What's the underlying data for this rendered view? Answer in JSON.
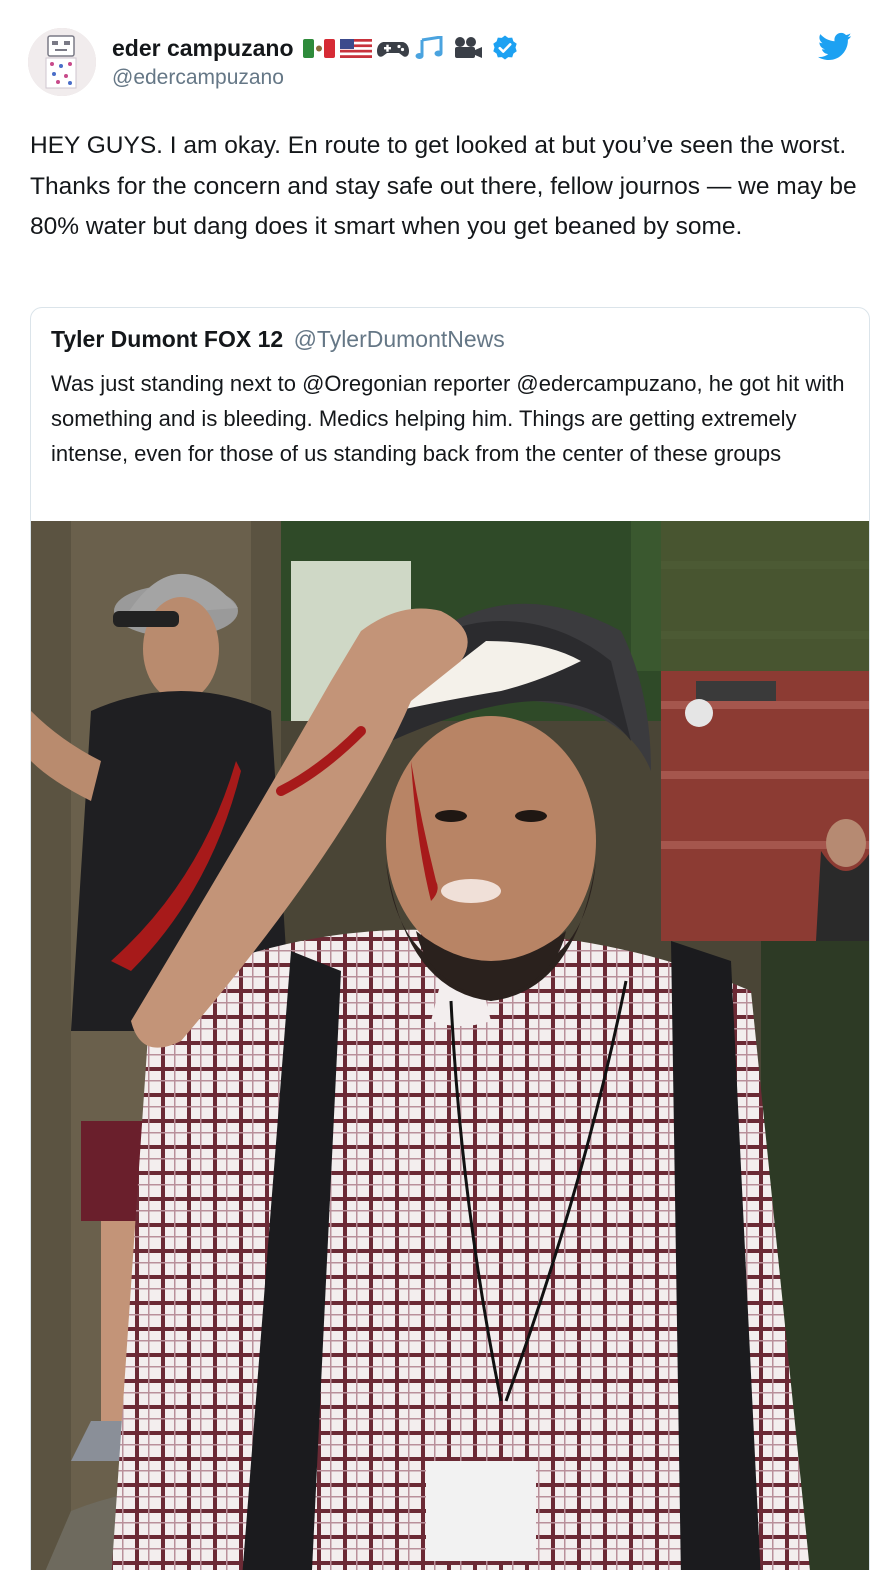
{
  "author": {
    "display_name": "eder campuzano",
    "handle": "@edercampuzano",
    "name_emojis": [
      "mexico-flag-icon",
      "us-flag-icon",
      "game-controller-icon",
      "music-notes-icon",
      "film-camera-icon"
    ],
    "verified": true
  },
  "tweet": {
    "text": "HEY GUYS. I am okay. En route to get looked at but you’ve seen the worst. Thanks for the concern and stay safe out there, fellow journos — we may be 80% water but dang does it smart when you get beaned by some."
  },
  "quoted_tweet": {
    "display_name": "Tyler Dumont FOX 12",
    "handle": "@TylerDumontNews",
    "text": "Was just standing next to @Oregonian reporter @edercampuzano, he got hit with something and is bleeding. Medics helping him. Things are getting extremely intense, even for those of us standing back from the center of these groups"
  },
  "colors": {
    "brand": "#1da1f2",
    "text_primary": "#14171a",
    "text_secondary": "#657786",
    "border": "#dbe4ea"
  },
  "icons": {
    "platform": "twitter-bird-icon",
    "verified": "verified-badge-icon"
  }
}
